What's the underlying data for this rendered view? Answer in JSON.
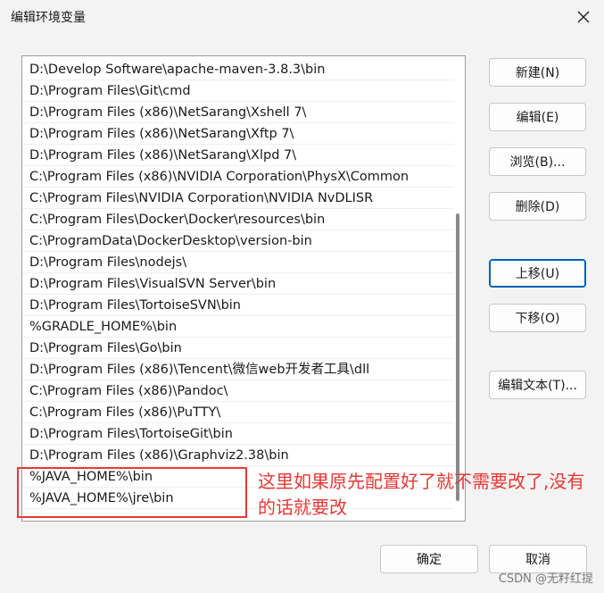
{
  "window": {
    "title": "编辑环境变量"
  },
  "path_list": [
    "D:\\Develop Software\\apache-maven-3.8.3\\bin",
    "D:\\Program Files\\Git\\cmd",
    "D:\\Program Files (x86)\\NetSarang\\Xshell 7\\",
    "D:\\Program Files (x86)\\NetSarang\\Xftp 7\\",
    "D:\\Program Files (x86)\\NetSarang\\Xlpd 7\\",
    "C:\\Program Files (x86)\\NVIDIA Corporation\\PhysX\\Common",
    "C:\\Program Files\\NVIDIA Corporation\\NVIDIA NvDLISR",
    "C:\\Program Files\\Docker\\Docker\\resources\\bin",
    "C:\\ProgramData\\DockerDesktop\\version-bin",
    "D:\\Program Files\\nodejs\\",
    "D:\\Program Files\\VisualSVN Server\\bin",
    "D:\\Program Files\\TortoiseSVN\\bin",
    "%GRADLE_HOME%\\bin",
    "D:\\Program Files\\Go\\bin",
    "D:\\Program Files (x86)\\Tencent\\微信web开发者工具\\dll",
    "C:\\Program Files (x86)\\Pandoc\\",
    "C:\\Program Files (x86)\\PuTTY\\",
    "D:\\Program Files\\TortoiseGit\\bin",
    "D:\\Program Files (x86)\\Graphviz2.38\\bin",
    "%JAVA_HOME%\\bin",
    "%JAVA_HOME%\\jre\\bin"
  ],
  "buttons": {
    "new": "新建(N)",
    "edit": "编辑(E)",
    "browse": "浏览(B)...",
    "delete": "删除(D)",
    "move_up": "上移(U)",
    "move_down": "下移(O)",
    "edit_text": "编辑文本(T)...",
    "ok": "确定",
    "cancel": "取消"
  },
  "annotation": {
    "text": "这里如果原先配置好了就不需要改了,没有的话就要改"
  },
  "watermark": "CSDN @无籽红提",
  "colors": {
    "annotation": "#e53935",
    "focus": "#005fb8"
  }
}
